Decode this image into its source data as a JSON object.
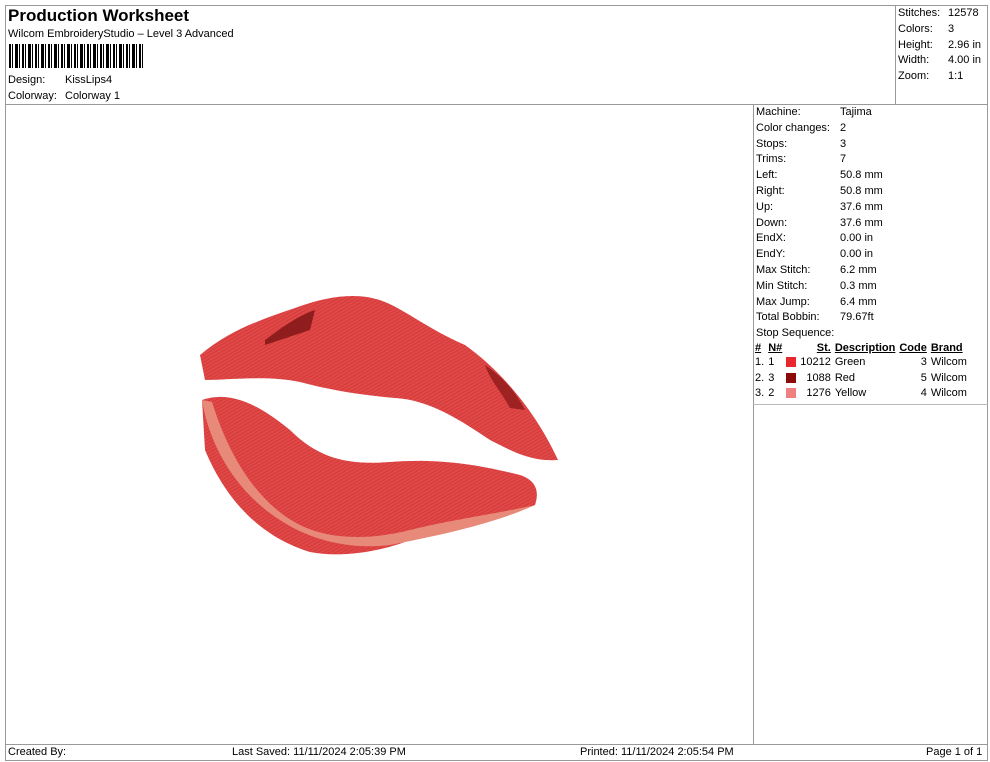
{
  "header": {
    "title": "Production Worksheet",
    "subtitle": "Wilcom EmbroideryStudio – Level 3 Advanced",
    "design_label": "Design:",
    "design": "KissLips4",
    "colorway_label": "Colorway:",
    "colorway": "Colorway 1"
  },
  "stats": [
    {
      "k": "Stitches:",
      "v": "12578"
    },
    {
      "k": "Colors:",
      "v": "3"
    },
    {
      "k": "Height:",
      "v": "2.96 in"
    },
    {
      "k": "Width:",
      "v": "4.00 in"
    },
    {
      "k": "Zoom:",
      "v": "1:1"
    }
  ],
  "machine": [
    {
      "k": "Machine:",
      "v": "Tajima"
    },
    {
      "k": "Color changes:",
      "v": "2"
    },
    {
      "k": "Stops:",
      "v": "3"
    },
    {
      "k": "Trims:",
      "v": "7"
    },
    {
      "k": "Left:",
      "v": "50.8 mm"
    },
    {
      "k": "Right:",
      "v": "50.8 mm"
    },
    {
      "k": "Up:",
      "v": "37.6 mm"
    },
    {
      "k": "Down:",
      "v": "37.6 mm"
    },
    {
      "k": "EndX:",
      "v": "0.00 in"
    },
    {
      "k": "EndY:",
      "v": "0.00 in"
    },
    {
      "k": "Max Stitch:",
      "v": "6.2 mm"
    },
    {
      "k": "Min Stitch:",
      "v": "0.3 mm"
    },
    {
      "k": "Max Jump:",
      "v": "6.4 mm"
    },
    {
      "k": "Total Bobbin:",
      "v": "79.67ft"
    }
  ],
  "stop_sequence": {
    "title": "Stop Sequence:",
    "headers": [
      "#",
      "N#",
      "St.",
      "Description",
      "Code",
      "Brand"
    ],
    "rows": [
      {
        "idx": "1.",
        "n": "1",
        "color": "#e8272f",
        "st": "10212",
        "desc": "Green",
        "code": "3",
        "brand": "Wilcom"
      },
      {
        "idx": "2.",
        "n": "3",
        "color": "#8b0a0a",
        "st": "1088",
        "desc": "Red",
        "code": "5",
        "brand": "Wilcom"
      },
      {
        "idx": "3.",
        "n": "2",
        "color": "#f08080",
        "st": "1276",
        "desc": "Yellow",
        "code": "4",
        "brand": "Wilcom"
      }
    ]
  },
  "footer": {
    "created": "Created By:",
    "saved": "Last Saved: 11/11/2024 2:05:39 PM",
    "printed": "Printed: 11/11/2024 2:05:54 PM",
    "page": "Page 1 of 1"
  }
}
